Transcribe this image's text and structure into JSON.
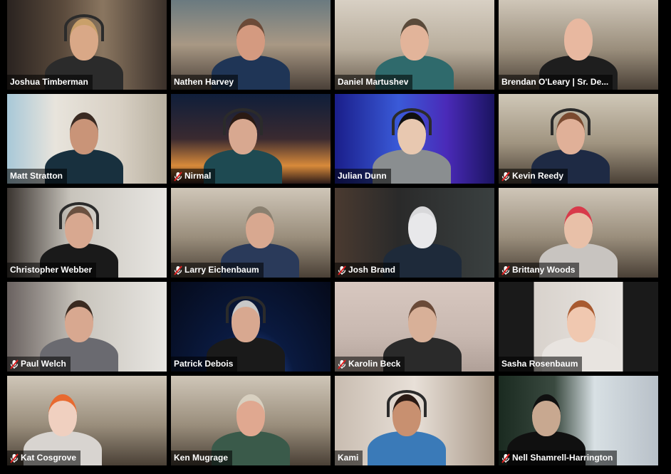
{
  "participants": [
    {
      "name": "Joshua Timberman",
      "muted": false
    },
    {
      "name": "Nathen Harvey",
      "muted": false
    },
    {
      "name": "Daniel Martushev",
      "muted": false
    },
    {
      "name": "Brendan O'Leary | Sr. De...",
      "muted": false
    },
    {
      "name": "Matt Stratton",
      "muted": false
    },
    {
      "name": "Nirmal",
      "muted": true
    },
    {
      "name": "Julian Dunn",
      "muted": false
    },
    {
      "name": "Kevin Reedy",
      "muted": true
    },
    {
      "name": "Christopher Webber",
      "muted": false
    },
    {
      "name": "Larry Eichenbaum",
      "muted": true
    },
    {
      "name": "Josh Brand",
      "muted": true
    },
    {
      "name": "Brittany Woods",
      "muted": true
    },
    {
      "name": "Paul Welch",
      "muted": true
    },
    {
      "name": "Patrick Debois",
      "muted": false,
      "speaking": true
    },
    {
      "name": "Karolin Beck",
      "muted": true
    },
    {
      "name": "Sasha Rosenbaum",
      "muted": false
    },
    {
      "name": "Kat Cosgrove",
      "muted": true
    },
    {
      "name": "Ken Mugrage",
      "muted": false
    },
    {
      "name": "Kami",
      "muted": false
    },
    {
      "name": "Nell Shamrell-Harrington",
      "muted": true
    }
  ],
  "colors": {
    "speaking_border": "#d8e85a",
    "muted_icon": "#e02020"
  }
}
